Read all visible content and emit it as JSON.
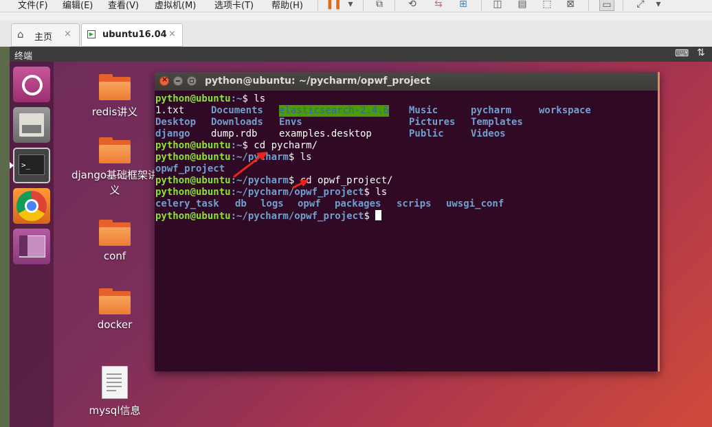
{
  "menu": [
    "文件(F)",
    "编辑(E)",
    "查看(V)",
    "虚拟机(M)",
    "选项卡(T)",
    "帮助(H)"
  ],
  "tabs": [
    {
      "label": "主页",
      "close": "×"
    },
    {
      "label": "ubuntu16.04",
      "close": "×"
    }
  ],
  "vm_header": {
    "title": "终端"
  },
  "desktop_icons": [
    {
      "label": "redis讲义",
      "type": "folder"
    },
    {
      "label": "django基础框架讲义",
      "type": "folder"
    },
    {
      "label": "conf",
      "type": "folder"
    },
    {
      "label": "docker",
      "type": "folder"
    },
    {
      "label": "mysql信息",
      "type": "document"
    }
  ],
  "launcher_items": [
    "ubuntu-dash-icon",
    "file-manager-icon",
    "terminal-icon",
    "chrome-icon",
    "workspace-switcher-icon"
  ],
  "terminal": {
    "title": "python@ubuntu: ~/pycharm/opwf_project",
    "user": "python@ubuntu",
    "lines": {
      "l1": {
        "path": ":~",
        "cmd": "$ ls"
      },
      "ls_home": {
        "r1": [
          "1.txt",
          "Documents",
          "elasticsearch-2.4.6",
          "Music",
          "pycharm",
          "workspace"
        ],
        "r2": [
          "Desktop",
          "Downloads",
          "Envs",
          "Pictures",
          "Templates"
        ],
        "r3": [
          "django",
          "dump.rdb",
          "examples.desktop",
          "Public",
          "Videos"
        ]
      },
      "l2": {
        "path": ":~",
        "cmd": "$ cd pycharm/"
      },
      "l3": {
        "path": ":~/pycharm",
        "cmd": "$ ls"
      },
      "ls_pycharm": "opwf_project",
      "l4": {
        "path": ":~/pycharm",
        "cmd": "$ cd opwf_project/"
      },
      "l5": {
        "path": ":~/pycharm/opwf_project",
        "cmd": "$ ls"
      },
      "ls_project": [
        "celery_task",
        "db",
        "logs",
        "opwf",
        "packages",
        "scrips",
        "uwsgi_conf"
      ],
      "l6": {
        "path": ":~/pycharm/opwf_project",
        "cmd": "$ "
      }
    }
  },
  "colors": {
    "terminal_bg": "#300a24",
    "prompt_user": "#8ae234",
    "prompt_path": "#729fcf",
    "directory": "#729fcf",
    "highlight_bg": "#4e9a06",
    "annotation_arrow": "#e8261c"
  }
}
